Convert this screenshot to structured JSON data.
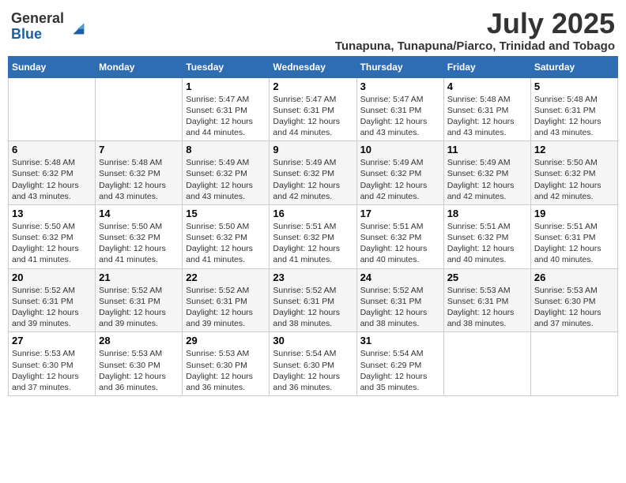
{
  "logo": {
    "general": "General",
    "blue": "Blue"
  },
  "title": "July 2025",
  "location": "Tunapuna, Tunapuna/Piarco, Trinidad and Tobago",
  "days_of_week": [
    "Sunday",
    "Monday",
    "Tuesday",
    "Wednesday",
    "Thursday",
    "Friday",
    "Saturday"
  ],
  "weeks": [
    [
      {
        "day": "",
        "info": ""
      },
      {
        "day": "",
        "info": ""
      },
      {
        "day": "1",
        "info": "Sunrise: 5:47 AM\nSunset: 6:31 PM\nDaylight: 12 hours and 44 minutes."
      },
      {
        "day": "2",
        "info": "Sunrise: 5:47 AM\nSunset: 6:31 PM\nDaylight: 12 hours and 44 minutes."
      },
      {
        "day": "3",
        "info": "Sunrise: 5:47 AM\nSunset: 6:31 PM\nDaylight: 12 hours and 43 minutes."
      },
      {
        "day": "4",
        "info": "Sunrise: 5:48 AM\nSunset: 6:31 PM\nDaylight: 12 hours and 43 minutes."
      },
      {
        "day": "5",
        "info": "Sunrise: 5:48 AM\nSunset: 6:31 PM\nDaylight: 12 hours and 43 minutes."
      }
    ],
    [
      {
        "day": "6",
        "info": "Sunrise: 5:48 AM\nSunset: 6:32 PM\nDaylight: 12 hours and 43 minutes."
      },
      {
        "day": "7",
        "info": "Sunrise: 5:48 AM\nSunset: 6:32 PM\nDaylight: 12 hours and 43 minutes."
      },
      {
        "day": "8",
        "info": "Sunrise: 5:49 AM\nSunset: 6:32 PM\nDaylight: 12 hours and 43 minutes."
      },
      {
        "day": "9",
        "info": "Sunrise: 5:49 AM\nSunset: 6:32 PM\nDaylight: 12 hours and 42 minutes."
      },
      {
        "day": "10",
        "info": "Sunrise: 5:49 AM\nSunset: 6:32 PM\nDaylight: 12 hours and 42 minutes."
      },
      {
        "day": "11",
        "info": "Sunrise: 5:49 AM\nSunset: 6:32 PM\nDaylight: 12 hours and 42 minutes."
      },
      {
        "day": "12",
        "info": "Sunrise: 5:50 AM\nSunset: 6:32 PM\nDaylight: 12 hours and 42 minutes."
      }
    ],
    [
      {
        "day": "13",
        "info": "Sunrise: 5:50 AM\nSunset: 6:32 PM\nDaylight: 12 hours and 41 minutes."
      },
      {
        "day": "14",
        "info": "Sunrise: 5:50 AM\nSunset: 6:32 PM\nDaylight: 12 hours and 41 minutes."
      },
      {
        "day": "15",
        "info": "Sunrise: 5:50 AM\nSunset: 6:32 PM\nDaylight: 12 hours and 41 minutes."
      },
      {
        "day": "16",
        "info": "Sunrise: 5:51 AM\nSunset: 6:32 PM\nDaylight: 12 hours and 41 minutes."
      },
      {
        "day": "17",
        "info": "Sunrise: 5:51 AM\nSunset: 6:32 PM\nDaylight: 12 hours and 40 minutes."
      },
      {
        "day": "18",
        "info": "Sunrise: 5:51 AM\nSunset: 6:32 PM\nDaylight: 12 hours and 40 minutes."
      },
      {
        "day": "19",
        "info": "Sunrise: 5:51 AM\nSunset: 6:31 PM\nDaylight: 12 hours and 40 minutes."
      }
    ],
    [
      {
        "day": "20",
        "info": "Sunrise: 5:52 AM\nSunset: 6:31 PM\nDaylight: 12 hours and 39 minutes."
      },
      {
        "day": "21",
        "info": "Sunrise: 5:52 AM\nSunset: 6:31 PM\nDaylight: 12 hours and 39 minutes."
      },
      {
        "day": "22",
        "info": "Sunrise: 5:52 AM\nSunset: 6:31 PM\nDaylight: 12 hours and 39 minutes."
      },
      {
        "day": "23",
        "info": "Sunrise: 5:52 AM\nSunset: 6:31 PM\nDaylight: 12 hours and 38 minutes."
      },
      {
        "day": "24",
        "info": "Sunrise: 5:52 AM\nSunset: 6:31 PM\nDaylight: 12 hours and 38 minutes."
      },
      {
        "day": "25",
        "info": "Sunrise: 5:53 AM\nSunset: 6:31 PM\nDaylight: 12 hours and 38 minutes."
      },
      {
        "day": "26",
        "info": "Sunrise: 5:53 AM\nSunset: 6:30 PM\nDaylight: 12 hours and 37 minutes."
      }
    ],
    [
      {
        "day": "27",
        "info": "Sunrise: 5:53 AM\nSunset: 6:30 PM\nDaylight: 12 hours and 37 minutes."
      },
      {
        "day": "28",
        "info": "Sunrise: 5:53 AM\nSunset: 6:30 PM\nDaylight: 12 hours and 36 minutes."
      },
      {
        "day": "29",
        "info": "Sunrise: 5:53 AM\nSunset: 6:30 PM\nDaylight: 12 hours and 36 minutes."
      },
      {
        "day": "30",
        "info": "Sunrise: 5:54 AM\nSunset: 6:30 PM\nDaylight: 12 hours and 36 minutes."
      },
      {
        "day": "31",
        "info": "Sunrise: 5:54 AM\nSunset: 6:29 PM\nDaylight: 12 hours and 35 minutes."
      },
      {
        "day": "",
        "info": ""
      },
      {
        "day": "",
        "info": ""
      }
    ]
  ]
}
